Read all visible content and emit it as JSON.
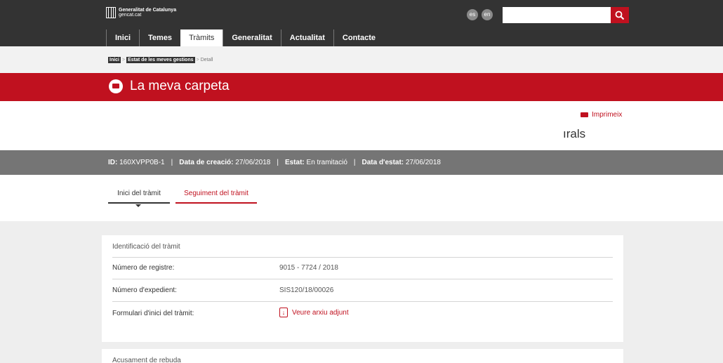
{
  "header": {
    "logo_line1": "Generalitat de Catalunya",
    "logo_line2": "gencat.cat",
    "languages": [
      "es",
      "en"
    ],
    "search_placeholder": "",
    "nav": [
      "Inici",
      "Temes",
      "Tràmits",
      "Generalitat",
      "Actualitat",
      "Contacte"
    ],
    "active_nav": "Tràmits"
  },
  "breadcrumb": {
    "items": [
      "Inici",
      "Estat de les meves gestions"
    ],
    "current": "Detall",
    "separator": ">"
  },
  "title_bar": {
    "title": "La meva carpeta",
    "icon": "folder-icon"
  },
  "actions": {
    "print_label": "Imprimeix",
    "heading_fragment": "ırals"
  },
  "info": {
    "id_label": "ID:",
    "id_value": "160XVPP0B-1",
    "creation_label": "Data de creació:",
    "creation_value": "27/06/2018",
    "status_label": "Estat:",
    "status_value": "En tramitació",
    "status_date_label": "Data d'estat:",
    "status_date_value": "27/06/2018",
    "separator": "|"
  },
  "tabs": [
    {
      "label": "Inici del tràmit"
    },
    {
      "label": "Seguiment del tràmit"
    }
  ],
  "identification": {
    "title": "Identificació del tràmit",
    "rows": [
      {
        "label": "Número de registre:",
        "value": "9015 - 7724 / 2018"
      },
      {
        "label": "Número d'expedient:",
        "value": "SIS120/18/00026"
      },
      {
        "label": "Formulari d'inici del tràmit:",
        "value": "Veure arxiu adjunt"
      }
    ]
  },
  "receipt": {
    "title": "Acusament de rebuda"
  },
  "colors": {
    "brand_red": "#c0111f",
    "header_dark": "#333333",
    "info_grey": "#757575"
  }
}
